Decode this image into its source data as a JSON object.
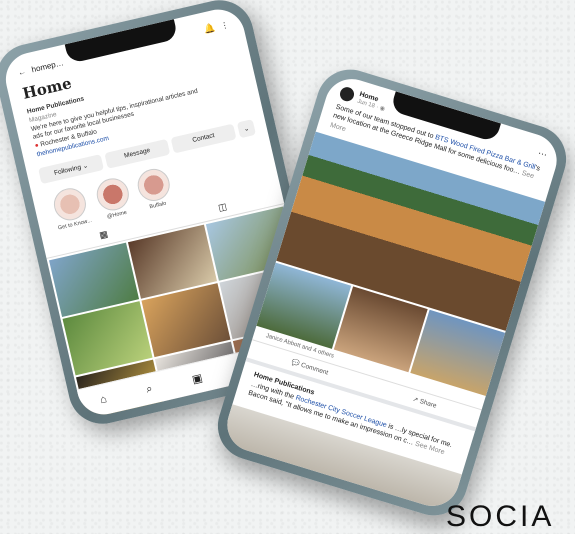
{
  "instagram": {
    "handle": "homep…",
    "name": "Home",
    "category": "Magazine",
    "bio_title": "Home Publications",
    "bio_line1": "We're here to give you helpful tips, inspirational articles and",
    "bio_line2": "ads for our favorite local businesses",
    "location": "Rochester & Buffalo",
    "link": "thehomepublications.com",
    "btn_following": "Following ⌄",
    "btn_message": "Message",
    "btn_contact": "Contact",
    "highlights": [
      "Get to Know...",
      "@Home",
      "Buffalo"
    ]
  },
  "facebook": {
    "page": "Home",
    "date": "Jun 18 · ◉",
    "text_pre": "Some of our team stopped out to",
    "text_link1": "BTS Wood Fired Pizza Bar & Grill",
    "text_mid": "'s new location at the Greece Ridge Mall for some delicious foo…",
    "see_more": "See More",
    "reactions": "Janice Abbott and 4 others",
    "action_comment": "Comment",
    "action_share": "Share",
    "post2_name": "Home Publications",
    "post2_pre": "…ring with the",
    "post2_link": "Rochester City Soccer League",
    "post2_text": "is …ly special for me. Bacon said, \"It allows me to make an impression on c…",
    "post2_see": "See More"
  },
  "tagline": "SOCIA"
}
